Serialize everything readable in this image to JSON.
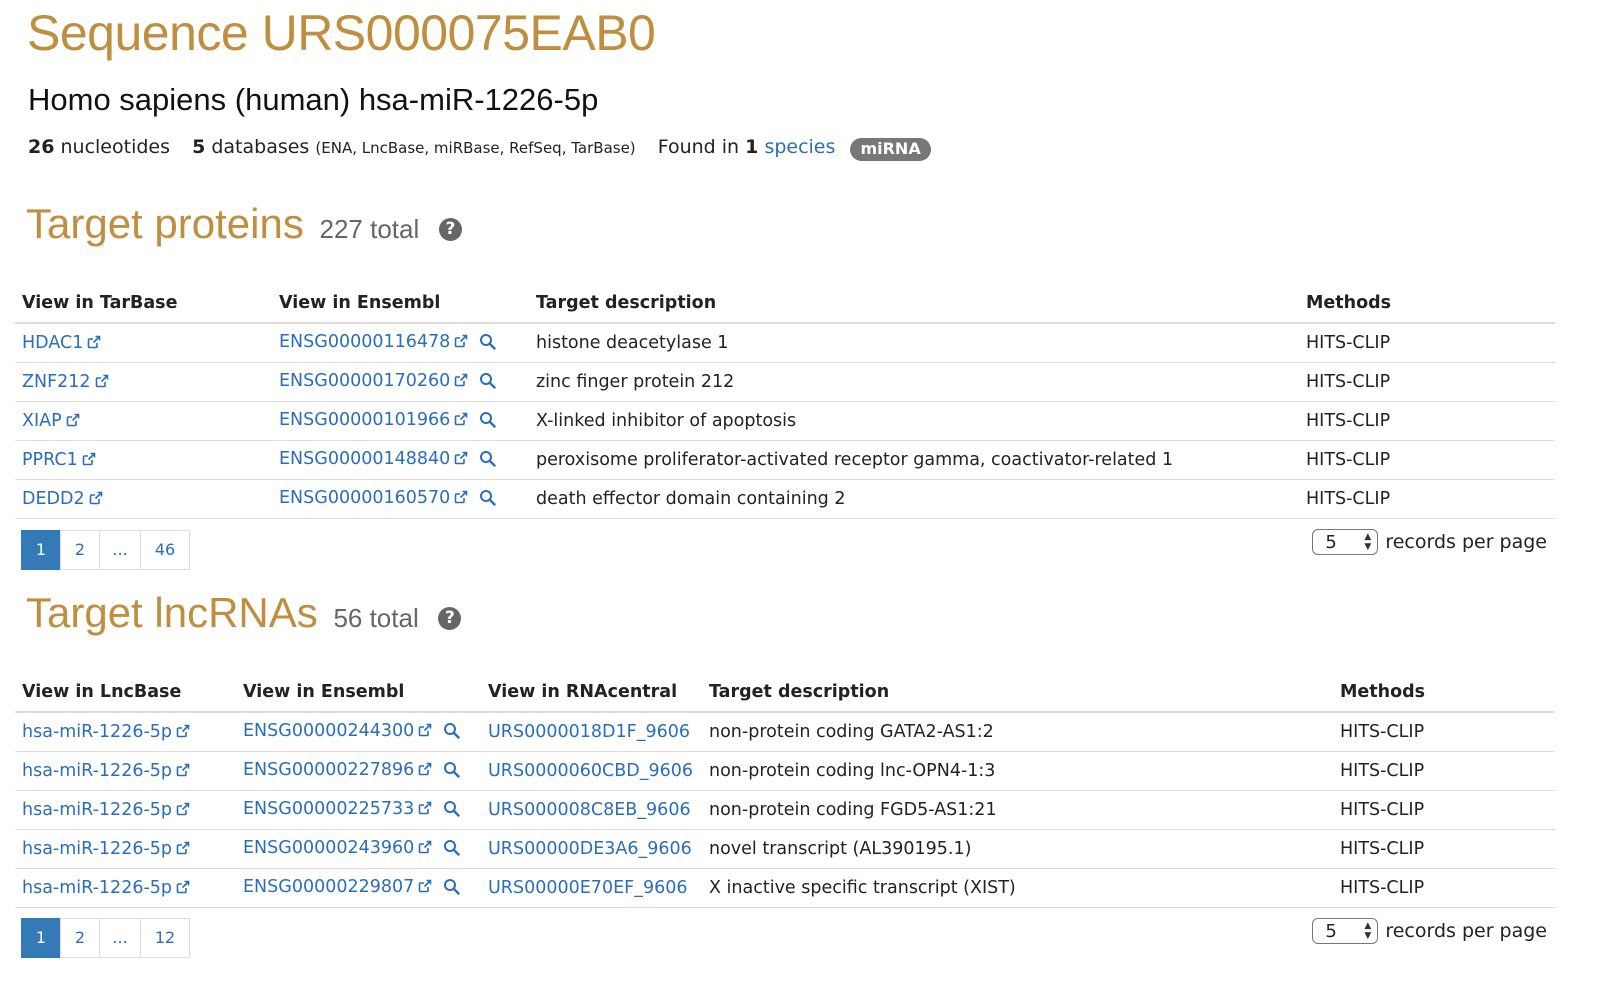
{
  "page": {
    "title": "Sequence URS000075EAB0",
    "subtitle": "Homo sapiens (human) hsa-miR-1226-5p",
    "stats": {
      "nucleotides_count": "26",
      "nucleotides_label": "nucleotides",
      "databases_count": "5",
      "databases_label": "databases",
      "databases_list": "(ENA, LncBase, miRBase, RefSeq, TarBase)",
      "found_in_label": "Found in",
      "species_count": "1",
      "species_link": "species",
      "badge": "miRNA"
    }
  },
  "proteins": {
    "title": "Target proteins",
    "total": "227 total",
    "help_icon": "question-circle-icon",
    "columns": [
      "View in TarBase",
      "View in Ensembl",
      "Target description",
      "Methods"
    ],
    "rows": [
      {
        "tarbase": "HDAC1",
        "ensembl": "ENSG00000116478",
        "description": "histone deacetylase 1",
        "method": "HITS-CLIP"
      },
      {
        "tarbase": "ZNF212",
        "ensembl": "ENSG00000170260",
        "description": "zinc finger protein 212",
        "method": "HITS-CLIP"
      },
      {
        "tarbase": "XIAP",
        "ensembl": "ENSG00000101966",
        "description": "X-linked inhibitor of apoptosis",
        "method": "HITS-CLIP"
      },
      {
        "tarbase": "PPRC1",
        "ensembl": "ENSG00000148840",
        "description": "peroxisome proliferator-activated receptor gamma, coactivator-related 1",
        "method": "HITS-CLIP"
      },
      {
        "tarbase": "DEDD2",
        "ensembl": "ENSG00000160570",
        "description": "death effector domain containing 2",
        "method": "HITS-CLIP"
      }
    ],
    "pagination": [
      "1",
      "2",
      "...",
      "46"
    ],
    "records_per_page_value": "5",
    "records_per_page_label": "records per page"
  },
  "lncrnas": {
    "title": "Target lncRNAs",
    "total": "56 total",
    "help_icon": "question-circle-icon",
    "columns": [
      "View in LncBase",
      "View in Ensembl",
      "View in RNAcentral",
      "Target description",
      "Methods"
    ],
    "rows": [
      {
        "lncbase": "hsa-miR-1226-5p",
        "ensembl": "ENSG00000244300",
        "rnacentral": "URS0000018D1F_9606",
        "description": "non-protein coding GATA2-AS1:2",
        "method": "HITS-CLIP"
      },
      {
        "lncbase": "hsa-miR-1226-5p",
        "ensembl": "ENSG00000227896",
        "rnacentral": "URS0000060CBD_9606",
        "description": "non-protein coding lnc-OPN4-1:3",
        "method": "HITS-CLIP"
      },
      {
        "lncbase": "hsa-miR-1226-5p",
        "ensembl": "ENSG00000225733",
        "rnacentral": "URS000008C8EB_9606",
        "description": "non-protein coding FGD5-AS1:21",
        "method": "HITS-CLIP"
      },
      {
        "lncbase": "hsa-miR-1226-5p",
        "ensembl": "ENSG00000243960",
        "rnacentral": "URS00000DE3A6_9606",
        "description": "novel transcript (AL390195.1)",
        "method": "HITS-CLIP"
      },
      {
        "lncbase": "hsa-miR-1226-5p",
        "ensembl": "ENSG00000229807",
        "rnacentral": "URS00000E70EF_9606",
        "description": "X inactive specific transcript (XIST)",
        "method": "HITS-CLIP"
      }
    ],
    "pagination": [
      "1",
      "2",
      "...",
      "12"
    ],
    "records_per_page_value": "5",
    "records_per_page_label": "records per page"
  },
  "icons": {
    "external_link": "external-link-icon",
    "search": "search-icon",
    "select_arrows": "up-down-arrows-icon"
  },
  "colors": {
    "heading": "#bf8e3e",
    "link": "#2a6ebb",
    "badge": "#777777",
    "active_page": "#337ab7"
  }
}
